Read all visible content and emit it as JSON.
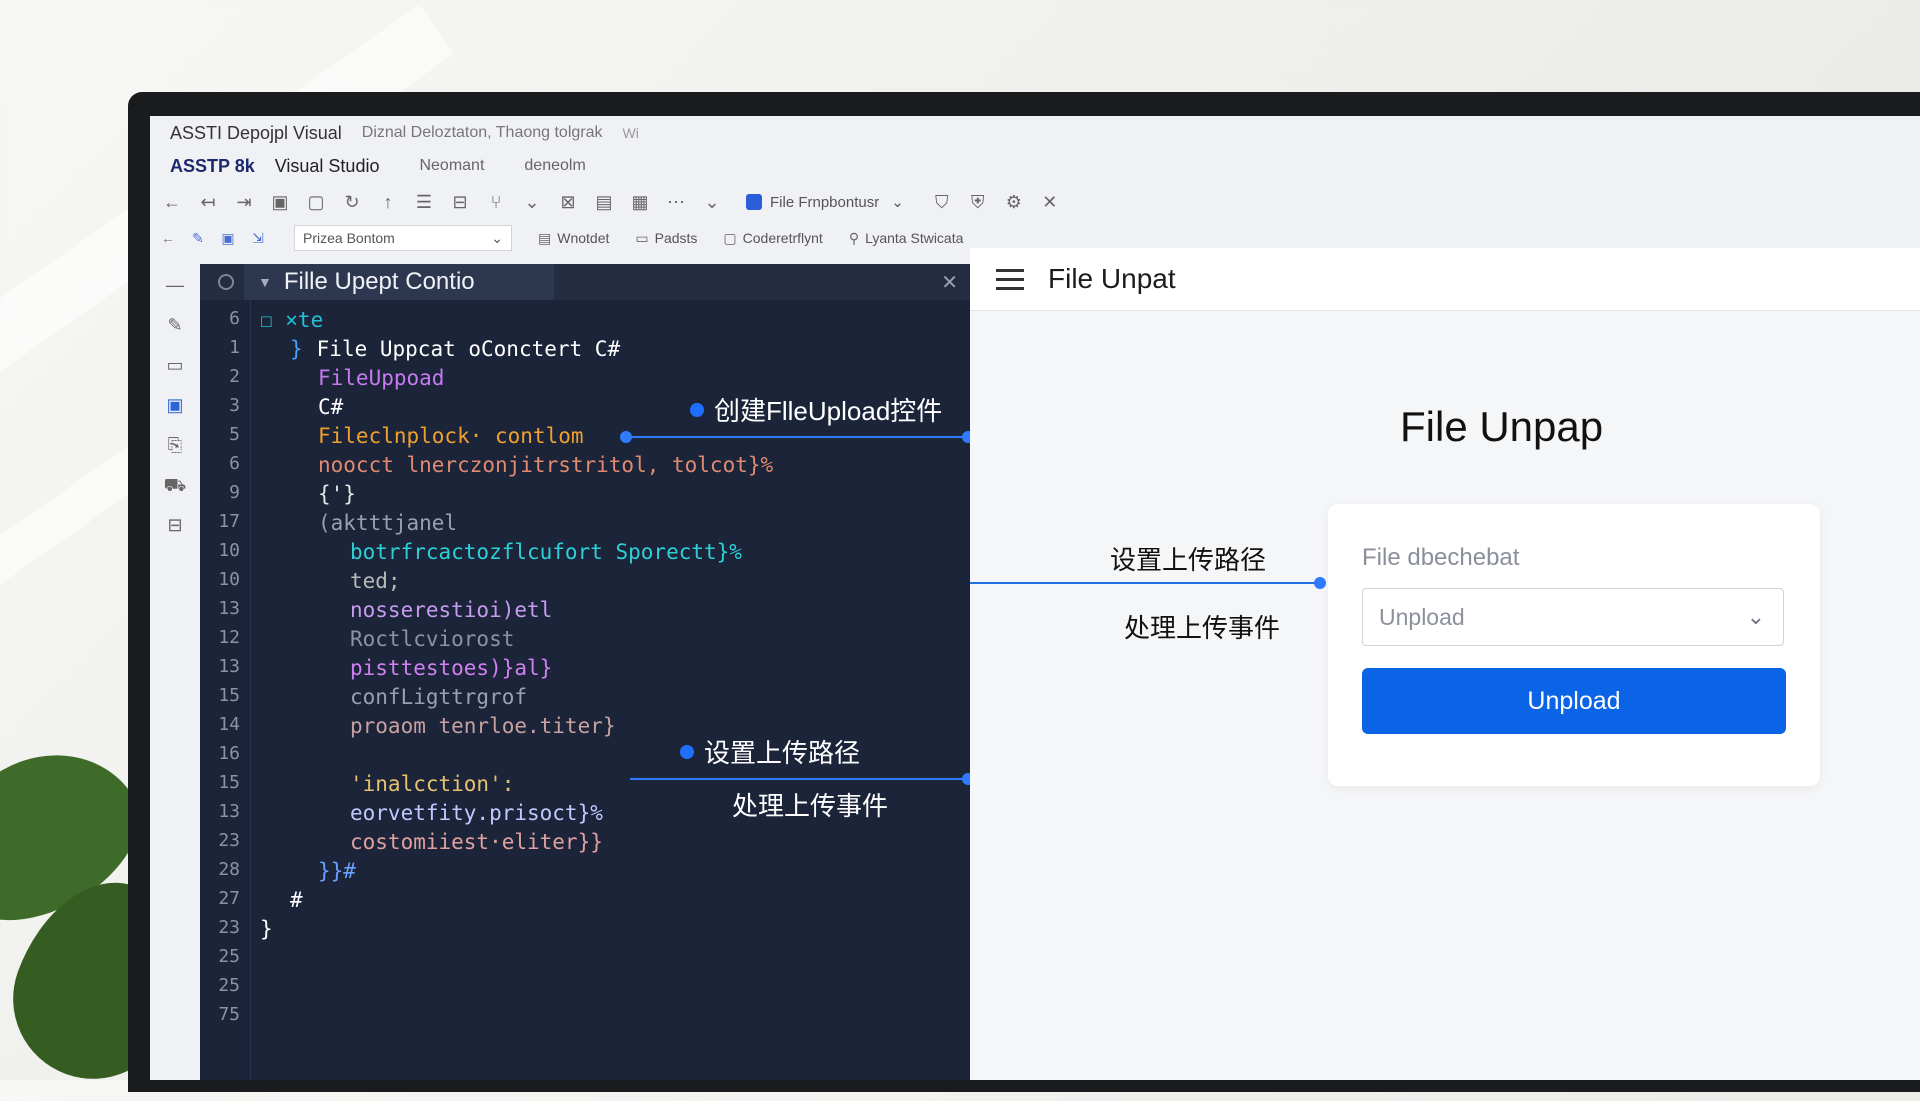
{
  "window": {
    "title_parts": [
      "ASSTI Depojpl Visual",
      "Diznal Deloztaton, Thaong tolgrak",
      "Wi"
    ],
    "menu_app": "ASSTP 8k",
    "menu_items": [
      "Visual Studio",
      "Neomant",
      "deneolm"
    ]
  },
  "toolbar": {
    "icons": [
      "back-icon",
      "forward-icon",
      "undo-icon",
      "save-icon",
      "copy-icon",
      "refresh-icon",
      "pin-icon",
      "layout-icon",
      "split-icon",
      "branch-icon",
      "dropdown-icon",
      "expand-icon",
      "doc-icon",
      "grid-icon",
      "more-icon",
      "dropdown-icon"
    ],
    "project_label": "File Frnpbontusr",
    "right_icons": [
      "lock-icon",
      "shield-icon",
      "settings-icon",
      "close-icon"
    ]
  },
  "toolbar2": {
    "combo_value": "Prizea Bontom",
    "tools": [
      {
        "icon": "doc-icon",
        "label": "Wnotdet"
      },
      {
        "icon": "page-icon",
        "label": "Padsts"
      },
      {
        "icon": "window-icon",
        "label": "Coderetrflynt"
      },
      {
        "icon": "search-icon",
        "label": "Lyanta Stwicata"
      }
    ]
  },
  "editor": {
    "tab_title": "Fille Upept Contio",
    "line_numbers": [
      "6",
      "1",
      "2",
      "3",
      "5",
      "6",
      "9",
      "17",
      "10",
      "10",
      "13",
      "12",
      "13",
      "15",
      "14",
      "16",
      "15",
      "13",
      "23",
      "28",
      "27",
      "23",
      "25",
      "25",
      "75"
    ],
    "code_lines": [
      {
        "text": "☐ ×te",
        "color": "#22c0d0",
        "indent": 0
      },
      {
        "text": "}",
        "color": "#4aa0ff",
        "indent": 1,
        "rest": "File Uppcat oConctert C#",
        "rest_color": "#ffffff"
      },
      {
        "text": "FileUppoad",
        "color": "#c87af0",
        "indent": 2
      },
      {
        "text": "C#",
        "color": "#ffffff",
        "indent": 2
      },
      {
        "text": "Fileclnplock· contlom",
        "color": "#f0a030",
        "indent": 2
      },
      {
        "text": "noocct lnerczonjitrstritol, tolcot}%",
        "color": "#e08a70",
        "indent": 2
      },
      {
        "text": "{'}",
        "color": "#e6e6e6",
        "indent": 2
      },
      {
        "text": "(aktttjanel",
        "color": "#9aa0b0",
        "indent": 2
      },
      {
        "text": "botrfrcactozflcufort Sporectt}%",
        "color": "#2ed0d8",
        "indent": 3
      },
      {
        "text": "ted;",
        "color": "#b8b8b8",
        "indent": 3
      },
      {
        "text": "nosserestioi)etl",
        "color": "#c69cf0",
        "indent": 3
      },
      {
        "text": "Roctlcviorost",
        "color": "#8a93a8",
        "indent": 3
      },
      {
        "text": "pisttestoes)}al}",
        "color": "#d080f0",
        "indent": 3
      },
      {
        "text": "confLigttrgrof",
        "color": "#9aa0b0",
        "indent": 3
      },
      {
        "text": "proaom tenrloe.titer}",
        "color": "#c8a0a0",
        "indent": 3
      },
      {
        "text": "",
        "color": "#ffffff",
        "indent": 3
      },
      {
        "text": "'inalcction':",
        "color": "#e8c070",
        "indent": 3
      },
      {
        "text": "eorvetfity.prisoct}%",
        "color": "#c0c8ff",
        "indent": 3
      },
      {
        "text": "costomiiest·eliter}}",
        "color": "#e0a0a0",
        "indent": 3
      },
      {
        "text": "}}#",
        "color": "#6aa0ff",
        "indent": 2
      },
      {
        "text": "#",
        "color": "#ffffff",
        "indent": 1
      },
      {
        "text": "}",
        "color": "#ffffff",
        "indent": 0
      },
      {
        "text": "",
        "color": "#ffffff",
        "indent": 0
      },
      {
        "text": "",
        "color": "#ffffff",
        "indent": 0
      }
    ],
    "annotations": {
      "create_control": "创建FlleUpload控件",
      "set_path": "设置上传路径",
      "handle_event": "处理上传事件"
    }
  },
  "preview": {
    "header_title": "File Unpat",
    "page_title": "File Unpap",
    "field_label": "File dbechebat",
    "select_value": "Unpload",
    "button_label": "Unpload",
    "side_label_path": "设置上传路径",
    "side_label_event": "处理上传事件"
  },
  "colors": {
    "accent": "#0b63e5",
    "editor_bg": "#1b2438",
    "connector": "#2f7bff"
  }
}
